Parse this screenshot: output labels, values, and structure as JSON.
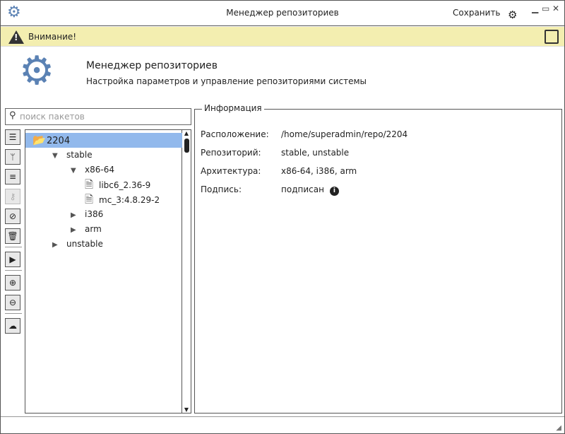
{
  "window": {
    "title": "Менеджер репозиториев",
    "save_label": "Сохранить"
  },
  "warning": {
    "label": "Внимание!"
  },
  "header": {
    "title": "Менеджер репозиториев",
    "subtitle": "Настройка параметров и управление репозиториями системы"
  },
  "search": {
    "placeholder": "поиск пакетов"
  },
  "tree": [
    {
      "label": "2204",
      "level": 0,
      "kind": "folder",
      "selected": true
    },
    {
      "label": "stable",
      "level": 1,
      "kind": "open"
    },
    {
      "label": "x86-64",
      "level": 2,
      "kind": "open"
    },
    {
      "label": "libc6_2.36-9",
      "level": 3,
      "kind": "file"
    },
    {
      "label": "mc_3:4.8.29-2",
      "level": 3,
      "kind": "file"
    },
    {
      "label": "i386",
      "level": 2,
      "kind": "closed"
    },
    {
      "label": "arm",
      "level": 2,
      "kind": "closed"
    },
    {
      "label": "unstable",
      "level": 1,
      "kind": "closed"
    }
  ],
  "info": {
    "legend": "Информация",
    "rows": [
      {
        "label": "Расположение:",
        "value": "/home/superadmin/repo/2204"
      },
      {
        "label": "Репозиторий:",
        "value": "stable, unstable"
      },
      {
        "label": "Архитектура:",
        "value": "x86-64, i386, arm"
      },
      {
        "label": "Подпись:",
        "value": "подписан"
      }
    ]
  }
}
